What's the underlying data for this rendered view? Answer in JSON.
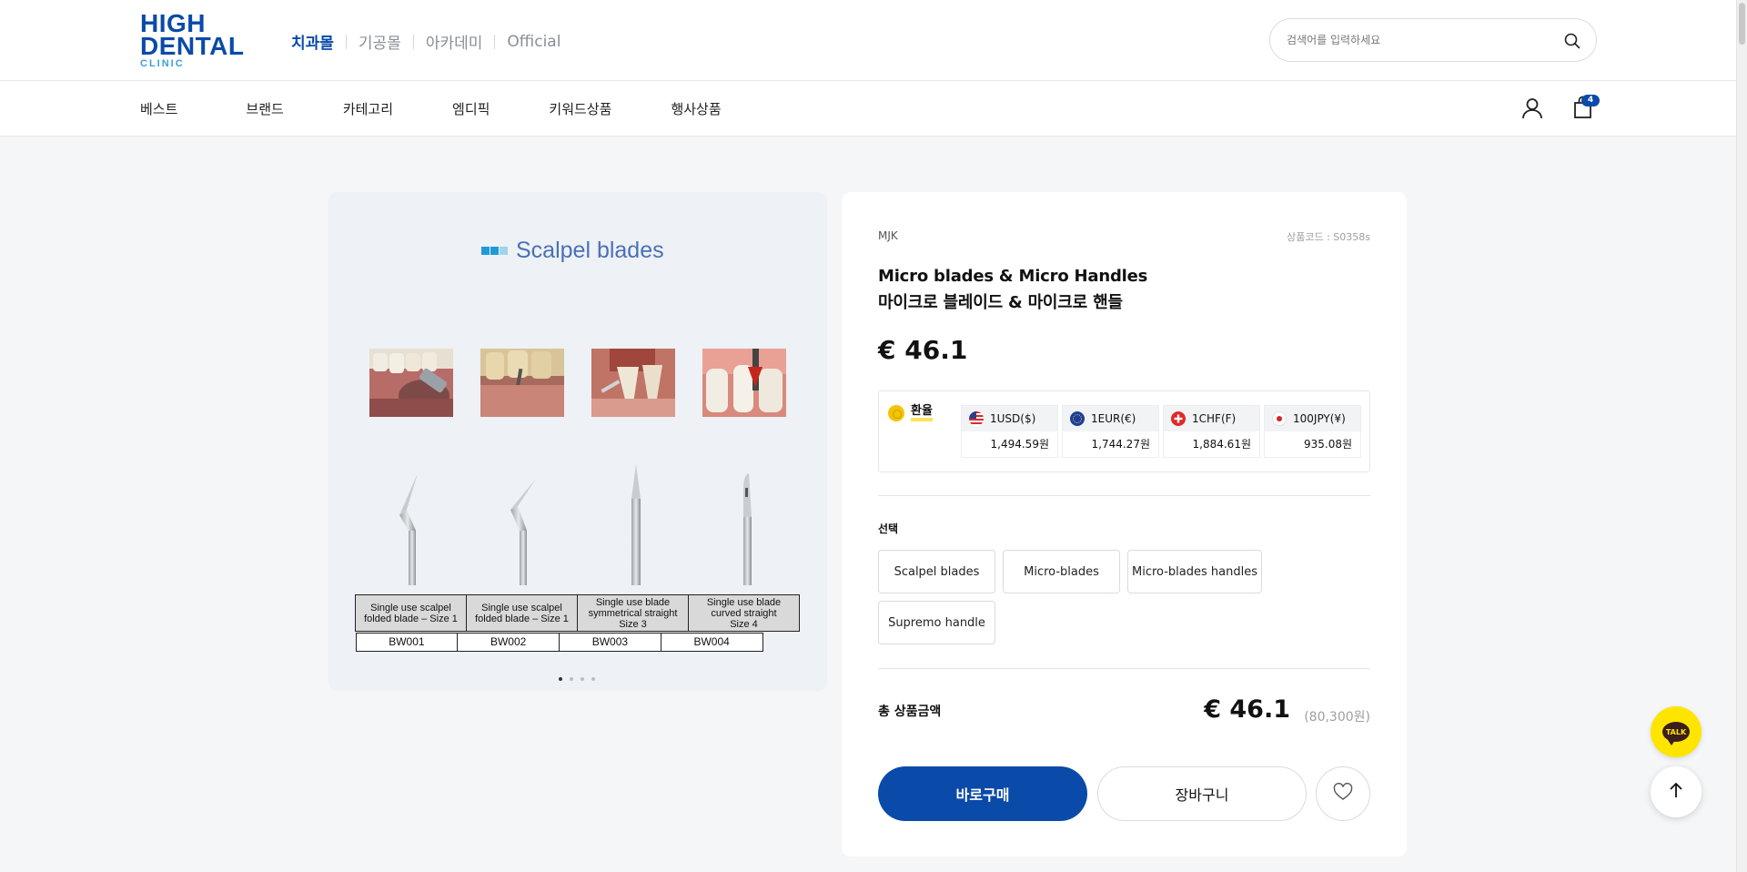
{
  "header": {
    "logo": {
      "line1": "HIGH",
      "line2": "DENTAL",
      "line3": "CLINIC"
    },
    "mall_tabs": [
      {
        "label": "치과몰",
        "active": true
      },
      {
        "label": "기공몰",
        "active": false
      },
      {
        "label": "아카데미",
        "active": false
      },
      {
        "label": "Official",
        "active": false
      }
    ],
    "search": {
      "placeholder": "검색어를 입력하세요",
      "value": "",
      "icon": "search-icon"
    }
  },
  "nav": {
    "categories": [
      "베스트",
      "브랜드",
      "카테고리",
      "엠디픽",
      "키워드상품",
      "행사상품"
    ],
    "icons": [
      "user-icon",
      "shopping-bag-icon"
    ],
    "cart_count": "4"
  },
  "gallery": {
    "image_title": "Scalpel blades",
    "spec_table": {
      "descriptions": [
        [
          "Single use scalpel",
          "folded blade – Size 1"
        ],
        [
          "Single use scalpel",
          "folded blade – Size 1"
        ],
        [
          "Single use blade",
          "symmetrical straight",
          "Size 3"
        ],
        [
          "Single use blade",
          "curved straight",
          "Size 4"
        ]
      ],
      "codes": [
        "BW001",
        "BW002",
        "BW003",
        "BW004"
      ]
    },
    "slide_count": 4,
    "active_slide": 0
  },
  "product": {
    "brand": "MJK",
    "code_label": "상품코드 : S0358s",
    "name_en": "Micro blades & Micro Handles",
    "name_ko": "마이크로 블레이드 & 마이크로 핸들",
    "price": "€ 46.1",
    "exchange": {
      "label": "환율",
      "rates": [
        {
          "currency": "1USD($)",
          "value": "1,494.59원",
          "flag": "us-flag-icon"
        },
        {
          "currency": "1EUR(€)",
          "value": "1,744.27원",
          "flag": "eu-flag-icon"
        },
        {
          "currency": "1CHF(F)",
          "value": "1,884.61원",
          "flag": "ch-flag-icon"
        },
        {
          "currency": "100JPY(¥)",
          "value": "935.08원",
          "flag": "jp-flag-icon"
        }
      ]
    },
    "option_title": "선택",
    "options": [
      "Scalpel blades",
      "Micro-blades",
      "Micro-blades handles",
      "Supremo handle"
    ],
    "total_label": "총 상품금액",
    "total_price": "€ 46.1",
    "total_krw": "(80,300원)",
    "buy_label": "바로구매",
    "cart_label": "장바구니"
  },
  "floating": {
    "talk_label": "TALK"
  },
  "colors": {
    "brand_blue": "#0a4aa8",
    "kakao_yellow": "#fde500"
  }
}
